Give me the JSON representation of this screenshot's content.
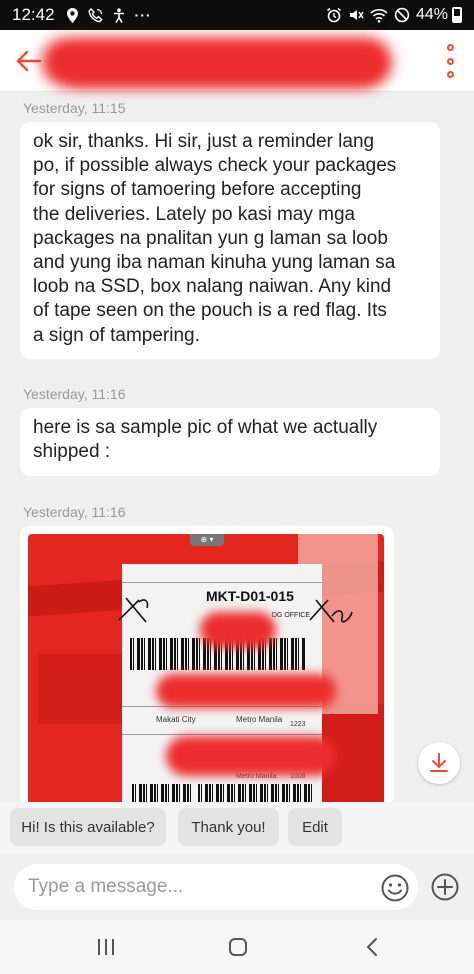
{
  "status_bar": {
    "time": "12:42",
    "battery": "44%",
    "left_icons": [
      "location-icon",
      "phone-icon",
      "accessibility-icon",
      "more-notifications-icon"
    ],
    "right_icons": [
      "alarm-icon",
      "mute-icon",
      "wifi-icon",
      "do-not-disturb-icon",
      "battery-icon"
    ]
  },
  "header": {
    "back_icon": "arrow-left-icon",
    "contact_name_redacted": true,
    "more_icon": "vertical-ellipsis-icon",
    "accent": "#ee4d2d"
  },
  "messages": [
    {
      "timestamp": "Yesterday, 11:15",
      "lines": [
        "ok sir, thanks.  Hi sir,  just a reminder lang",
        "po, if possible always check your packages",
        "for signs of tamoering before accepting",
        "the deliveries. Lately po kasi may mga",
        "packages na pnalitan yun g laman sa loob",
        "and yung iba naman kinuha yung laman sa",
        "loob na SSD, box nalang naiwan. Any kind",
        "of tape seen on the pouch is a red flag. Its",
        "a sign of tampering."
      ]
    },
    {
      "timestamp": "Yesterday, 11:16",
      "lines": [
        "here is sa sample pic of what we actually",
        "shipped :"
      ]
    },
    {
      "timestamp": "Yesterday, 11:16",
      "image": {
        "code": "MKT-D01-015",
        "dg_office": "DG OFFICE",
        "city_left": "Makati City",
        "city_right": "Metro Manila",
        "number_1": "1223",
        "city_lower": "Metro Manila",
        "number_2": "1008",
        "package_color": "#e3261f"
      }
    }
  ],
  "download_icon": "download-icon",
  "quick_replies": [
    "Hi! Is this available?",
    "Thank you!",
    "Edit"
  ],
  "composer": {
    "placeholder": "Type a message...",
    "emoji_icon": "smiley-icon",
    "add_icon": "plus-circle-icon"
  },
  "nav_bar": [
    "recent-apps-icon",
    "home-icon",
    "back-icon"
  ]
}
